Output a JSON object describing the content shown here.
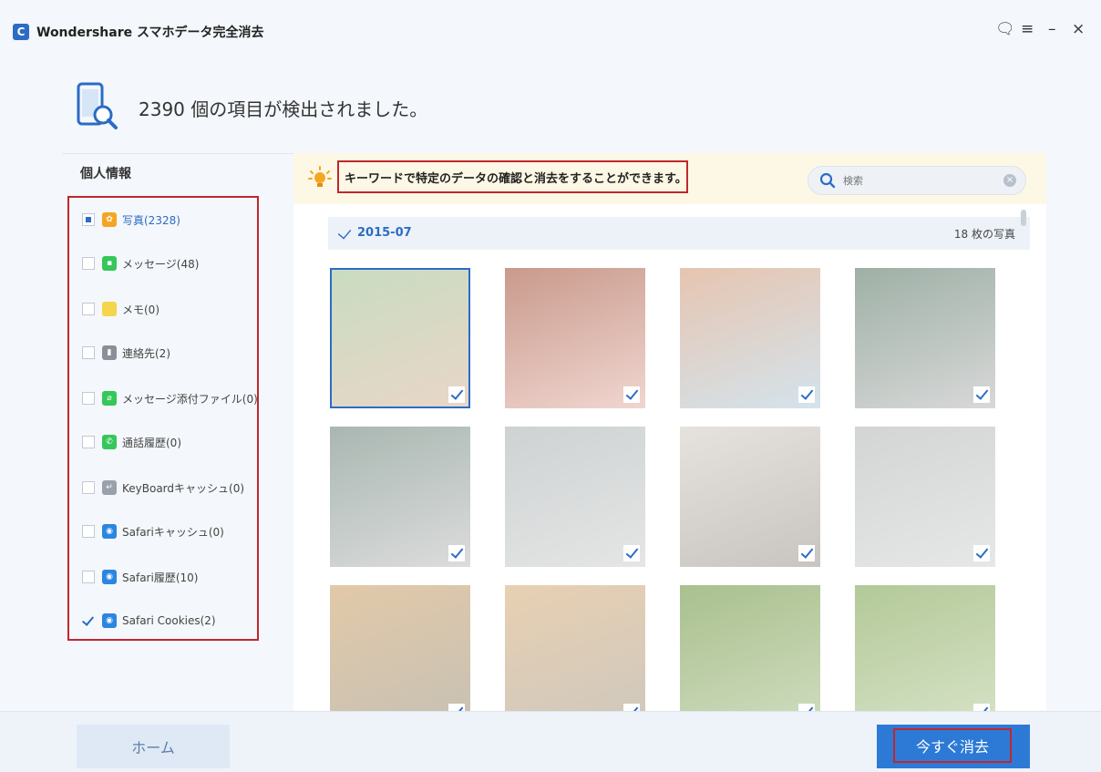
{
  "window": {
    "app_logo": "C",
    "title": "Wondershare スマホデータ完全消去",
    "controls": {
      "feedback": "🗨",
      "menu": "≡",
      "minimize": "–",
      "close": "×"
    }
  },
  "scan": {
    "result_title": "2390 個の項目が検出されました。"
  },
  "sidebar": {
    "heading": "個人情報",
    "items": [
      {
        "label": "写真(2328)",
        "state": "partial",
        "icon": "photos-icon",
        "color": "#f4a623"
      },
      {
        "label": "メッセージ(48)",
        "state": "unchecked",
        "icon": "message-icon",
        "color": "#35c759"
      },
      {
        "label": "メモ(0)",
        "state": "unchecked",
        "icon": "notes-icon",
        "color": "#f5d54a"
      },
      {
        "label": "連絡先(2)",
        "state": "unchecked",
        "icon": "contacts-icon",
        "color": "#8a8f99"
      },
      {
        "label": "メッセージ添付ファイル(0)",
        "state": "unchecked",
        "icon": "attachment-icon",
        "color": "#35c759"
      },
      {
        "label": "通話履歴(0)",
        "state": "unchecked",
        "icon": "call-icon",
        "color": "#35c759"
      },
      {
        "label": "KeyBoardキャッシュ(0)",
        "state": "unchecked",
        "icon": "keyboard-icon",
        "color": "#9aa1ab"
      },
      {
        "label": "Safariキャッシュ(0)",
        "state": "unchecked",
        "icon": "safari-icon",
        "color": "#2b86e0"
      },
      {
        "label": "Safari履歴(10)",
        "state": "unchecked",
        "icon": "safari-icon",
        "color": "#2b86e0"
      },
      {
        "label": "Safari Cookies(2)",
        "state": "checked",
        "icon": "safari-icon",
        "color": "#2b86e0"
      }
    ]
  },
  "tip": {
    "text": "キーワードで特定のデータの確認と消去をすることができます。"
  },
  "search": {
    "placeholder": "検索",
    "value": ""
  },
  "gallery": {
    "date_label": "2015-07",
    "count_label": "18 枚の写真",
    "photos": [
      {
        "desc": "boy-with-cake",
        "c1": "#c8dcc0",
        "c2": "#e9d6c8",
        "selected": true
      },
      {
        "desc": "women-party",
        "c1": "#c99a8c",
        "c2": "#f0d6d0",
        "selected": false
      },
      {
        "desc": "kids-party-hats",
        "c1": "#e6c5b0",
        "c2": "#d4e3ec",
        "selected": false
      },
      {
        "desc": "cup-on-desk-1",
        "c1": "#9eb0a6",
        "c2": "#d8d8d8",
        "selected": false
      },
      {
        "desc": "cup-on-desk-2",
        "c1": "#a9b7b1",
        "c2": "#dcdcdc",
        "selected": false
      },
      {
        "desc": "disc-closeup-1",
        "c1": "#cfd2d2",
        "c2": "#e4e6e6",
        "selected": false
      },
      {
        "desc": "white-fabric",
        "c1": "#e6e2de",
        "c2": "#c8c5c1",
        "selected": false
      },
      {
        "desc": "disc-closeup-2",
        "c1": "#d3d5d5",
        "c2": "#e6e8e8",
        "selected": false
      },
      {
        "desc": "bottle-1",
        "c1": "#e2c9a8",
        "c2": "#c7c1b4",
        "selected": false
      },
      {
        "desc": "bottle-2",
        "c1": "#e8d0b2",
        "c2": "#cfc8bd",
        "selected": false
      },
      {
        "desc": "plant-1",
        "c1": "#a9c08e",
        "c2": "#cfdcbe",
        "selected": false
      },
      {
        "desc": "plant-2",
        "c1": "#b3c998",
        "c2": "#d6e2c6",
        "selected": false
      }
    ]
  },
  "footer": {
    "home_label": "ホーム",
    "erase_label": "今すぐ消去"
  },
  "colors": {
    "accent": "#2b6cc4",
    "highlight_border": "#c0272d",
    "primary_button": "#2d7ad6"
  }
}
